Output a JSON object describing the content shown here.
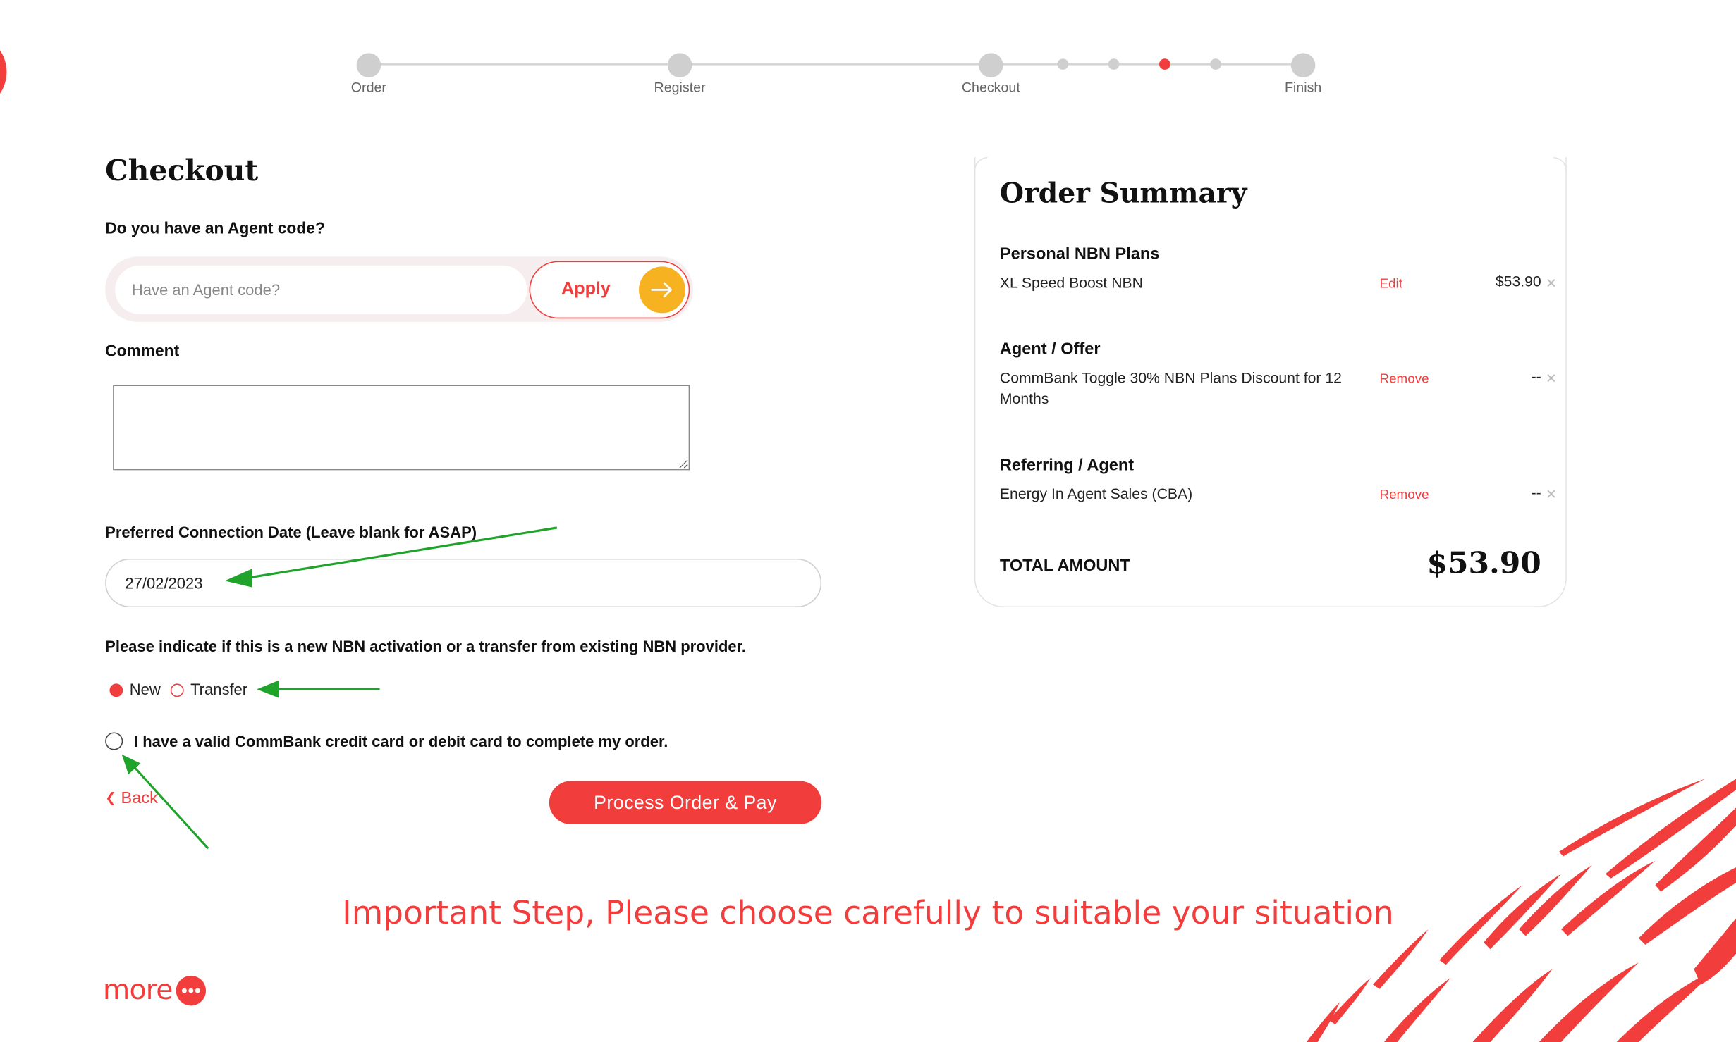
{
  "stepper": {
    "steps": [
      "Order",
      "Register",
      "Checkout",
      "Finish"
    ],
    "active_substep": 3
  },
  "checkout": {
    "title": "Checkout",
    "agent_question": "Do you have an Agent code?",
    "agent_placeholder": "Have an Agent code?",
    "apply_label": "Apply",
    "comment_label": "Comment",
    "date_label": "Preferred Connection Date (Leave blank for ASAP)",
    "date_value": "27/02/2023",
    "nbn_question": "Please indicate if this is a new NBN activation or a transfer from existing NBN provider.",
    "option_new": "New",
    "option_transfer": "Transfer",
    "selected_option": "New",
    "card_confirm": "I have a valid CommBank credit card or debit card to complete my order.",
    "back_label": "Back",
    "pay_label": "Process Order & Pay"
  },
  "summary": {
    "title": "Order Summary",
    "sections": [
      {
        "heading": "Personal NBN Plans",
        "item": "XL Speed Boost NBN",
        "action": "Edit",
        "price": "$53.90"
      },
      {
        "heading": "Agent / Offer",
        "item": "CommBank Toggle 30% NBN Plans Discount for 12 Months",
        "action": "Remove",
        "price": "--"
      },
      {
        "heading": "Referring / Agent",
        "item": "Energy In Agent Sales (CBA)",
        "action": "Remove",
        "price": "--"
      }
    ],
    "total_label": "TOTAL AMOUNT",
    "total_value": "$53.90"
  },
  "annotation_note": "Important Step, Please choose carefully to suitable your situation",
  "logo_text": "more",
  "colors": {
    "brand_red": "#f23d3d",
    "accent_yellow": "#f7b222",
    "annotation_green": "#1fa32a"
  }
}
